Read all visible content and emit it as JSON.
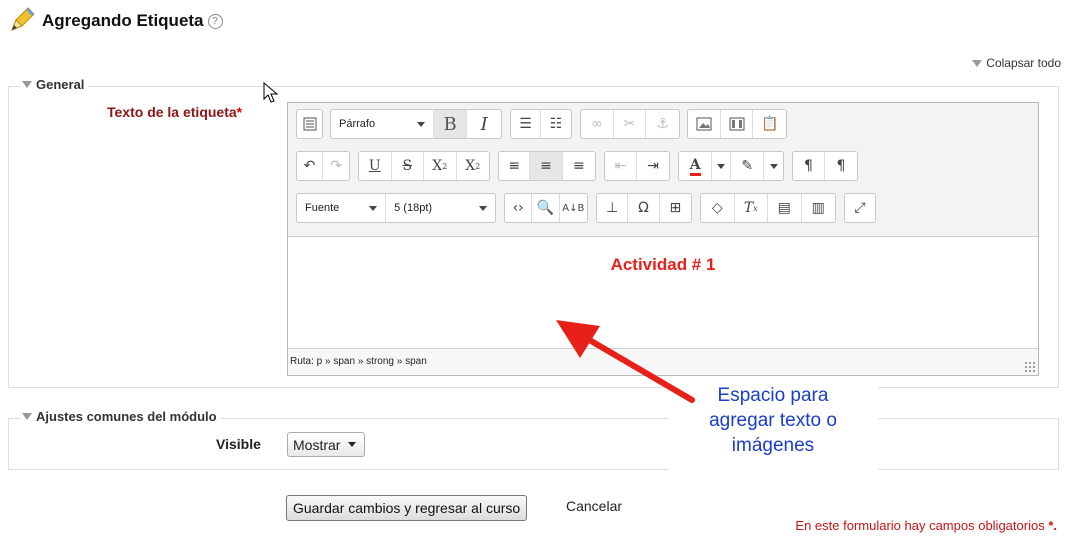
{
  "page": {
    "title": "Agregando Etiqueta",
    "help": "?",
    "collapse_all": "Colapsar todo"
  },
  "general": {
    "legend": "General",
    "label": "Texto de la etiqueta",
    "required_mark": "*"
  },
  "editor": {
    "paragraph_select": "Párrafo",
    "font_select": "Fuente",
    "size_select": "5 (18pt)",
    "content": "Actividad # 1",
    "status_path": "Ruta: p » span » strong » span",
    "toolbar_row1": [
      "kitchen-sink-icon",
      "bold-icon",
      "italic-icon",
      "bullet-list-icon",
      "numbered-list-icon",
      "link-icon",
      "unlink-icon",
      "anchor-icon",
      "image-icon",
      "media-icon",
      "paste-icon"
    ],
    "toolbar_row2": [
      "undo-icon",
      "redo-icon",
      "underline-icon",
      "strikethrough-icon",
      "subscript-icon",
      "superscript-icon",
      "align-left-icon",
      "align-center-icon",
      "align-right-icon",
      "outdent-icon",
      "indent-icon",
      "text-color-icon",
      "highlight-icon",
      "ltr-icon",
      "rtl-icon"
    ],
    "toolbar_row3": [
      "code-icon",
      "find-icon",
      "replace-icon",
      "insert-icon",
      "omega-icon",
      "table-icon",
      "clean-icon",
      "clear-format-icon",
      "paste-text-icon",
      "paste-word-icon",
      "fullscreen-icon"
    ]
  },
  "annotation": {
    "line1": "Espacio para",
    "line2": "agregar texto o",
    "line3": "imágenes"
  },
  "module": {
    "legend": "Ajustes comunes del módulo",
    "visible_label": "Visible",
    "visible_value": "Mostrar"
  },
  "actions": {
    "save": "Guardar cambios y regresar al curso",
    "cancel": "Cancelar"
  },
  "footer": {
    "required_note": "En este formulario hay campos obligatorios",
    "required_mark": "*."
  },
  "colors": {
    "label": "#8b1414",
    "content": "#e8201a",
    "callout_text": "#1b3dc7",
    "arrow": "#e8201a"
  }
}
